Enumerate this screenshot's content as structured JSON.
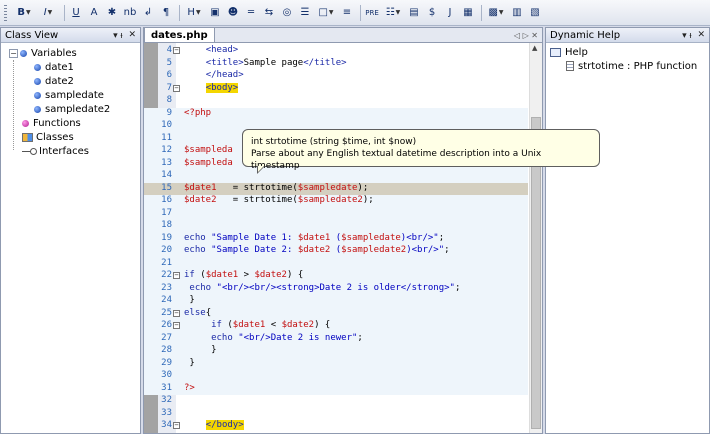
{
  "toolbar": {
    "items": [
      {
        "label": "B",
        "dropdown": true
      },
      {
        "label": "I",
        "dropdown": true
      },
      {
        "label": "U"
      },
      {
        "label": "A"
      },
      {
        "label": "✱"
      },
      {
        "label": "nb"
      },
      {
        "label": "↲"
      },
      {
        "label": "¶"
      },
      {
        "label": "H",
        "dropdown": true
      },
      {
        "label": "▣"
      },
      {
        "label": "☻"
      },
      {
        "label": "═"
      },
      {
        "label": "⇆"
      },
      {
        "label": "◎"
      },
      {
        "label": "☰"
      },
      {
        "label": "□",
        "dropdown": true
      },
      {
        "label": "≡"
      },
      {
        "label": "PRE"
      },
      {
        "label": "☷",
        "dropdown": true
      },
      {
        "label": "▤"
      },
      {
        "label": "$"
      },
      {
        "label": "J"
      },
      {
        "label": "▦"
      },
      {
        "label": "▩",
        "dropdown": true
      },
      {
        "label": "▥"
      },
      {
        "label": "▧"
      }
    ]
  },
  "class_view": {
    "title": "Class View",
    "pin": "▾ ᵼ",
    "close": "✕",
    "tree": [
      {
        "label": "Variables",
        "level": 0,
        "expander": "−",
        "icon": "variable"
      },
      {
        "label": "date1",
        "level": 1,
        "icon": "variable"
      },
      {
        "label": "date2",
        "level": 1,
        "icon": "variable"
      },
      {
        "label": "sampledate",
        "level": 1,
        "icon": "variable"
      },
      {
        "label": "sampledate2",
        "level": 1,
        "icon": "variable"
      },
      {
        "label": "Functions",
        "level": 0,
        "icon": "function"
      },
      {
        "label": "Classes",
        "level": 0,
        "icon": "class"
      },
      {
        "label": "Interfaces",
        "level": 0,
        "icon": "interface"
      }
    ]
  },
  "editor": {
    "tab_label": "dates.php",
    "tab_nav": "◁ ▷ ✕",
    "tooltip": {
      "line1": "int strtotime (string $time, int $now)",
      "line2": "Parse about any English textual datetime description into a Unix timestamp"
    },
    "lines": [
      {
        "n": "4",
        "fold": "−",
        "code": "    <head>"
      },
      {
        "n": "5",
        "code": "    <title>Sample page</title>"
      },
      {
        "n": "6",
        "code": "    </head>"
      },
      {
        "n": "7",
        "fold": "−",
        "code": "    <body>"
      },
      {
        "n": "8",
        "code": ""
      },
      {
        "n": "9",
        "code": "<?php"
      },
      {
        "n": "10",
        "code": ""
      },
      {
        "n": "11",
        "code": ""
      },
      {
        "n": "12",
        "code": "$sampleda"
      },
      {
        "n": "13",
        "code": "$sampleda"
      },
      {
        "n": "14",
        "code": ""
      },
      {
        "n": "15",
        "code": "$date1   = strtotime($sampledate);"
      },
      {
        "n": "16",
        "code": "$date2   = strtotime($sampledate2);"
      },
      {
        "n": "17",
        "code": ""
      },
      {
        "n": "18",
        "code": ""
      },
      {
        "n": "19",
        "code": "echo \"Sample Date 1: $date1 ($sampledate)<br/>\";"
      },
      {
        "n": "20",
        "code": "echo \"Sample Date 2: $date2 ($sampledate2)<br/>\";"
      },
      {
        "n": "21",
        "code": ""
      },
      {
        "n": "22",
        "fold": "−",
        "code": "if ($date1 > $date2) {"
      },
      {
        "n": "23",
        "code": " echo \"<br/><br/><strong>Date 2 is older</strong>\";"
      },
      {
        "n": "24",
        "code": " }"
      },
      {
        "n": "25",
        "fold": "−",
        "code": "else{"
      },
      {
        "n": "26",
        "fold": "−",
        "code": "     if ($date1 < $date2) {"
      },
      {
        "n": "27",
        "code": "     echo \"<br/>Date 2 is newer\";"
      },
      {
        "n": "28",
        "code": "     }"
      },
      {
        "n": "29",
        "code": " }"
      },
      {
        "n": "30",
        "code": ""
      },
      {
        "n": "31",
        "code": "?>"
      },
      {
        "n": "32",
        "code": ""
      },
      {
        "n": "33",
        "code": ""
      },
      {
        "n": "34",
        "fold": "−",
        "code": "    </body>"
      }
    ]
  },
  "dynamic_help": {
    "title": "Dynamic Help",
    "pin": "▾ ᵼ",
    "close": "✕",
    "items": [
      {
        "label": "Help",
        "icon": "book"
      },
      {
        "label": "strtotime : PHP function",
        "icon": "document"
      }
    ]
  }
}
